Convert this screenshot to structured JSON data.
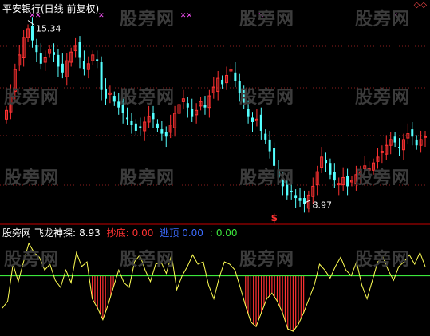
{
  "header": {
    "title": "平安银行(日线 前复权)",
    "corner_markers": "◇◇"
  },
  "main_chart": {
    "high_label": "15.34",
    "low_label": "8.97",
    "signal_mark": "$",
    "top_marks": [
      "✕✕",
      "✕",
      "✕✕",
      "✕",
      "✕"
    ]
  },
  "indicator": {
    "site_label": "股旁网",
    "name_label": "飞龙神探:",
    "name_value": "8.93",
    "bottom_label": "抄底:",
    "bottom_value": "0.00",
    "escape_label": "逃顶",
    "escape_value": "0.00",
    "extra_label": ":",
    "extra_value": "0.00"
  },
  "watermark": "股旁网",
  "colors": {
    "background": "#000000",
    "up": "#ff3232",
    "down": "#54ffff",
    "line": "#ffff54",
    "baseline": "#3ce63c",
    "divider": "#c80000",
    "bottom_bars": "#ff3232",
    "escape": "#3c6cff",
    "white": "#ffffff"
  },
  "chart_data": [
    {
      "type": "candlestick",
      "title": "平安银行(日线 前复权)",
      "annotations": [
        {
          "text": "15.34",
          "kind": "high"
        },
        {
          "text": "8.97",
          "kind": "low"
        }
      ],
      "close_series": [
        12.2,
        12.8,
        13.6,
        14.1,
        14.7,
        15.0,
        14.6,
        14.2,
        13.8,
        14.0,
        14.3,
        14.1,
        13.7,
        13.5,
        13.9,
        14.2,
        14.4,
        14.0,
        13.6,
        13.8,
        14.1,
        13.9,
        12.9,
        12.6,
        12.8,
        12.5,
        12.3,
        12.1,
        11.9,
        11.7,
        11.5,
        11.6,
        11.8,
        12.0,
        11.9,
        11.6,
        11.4,
        11.3,
        11.7,
        12.1,
        12.4,
        12.6,
        12.3,
        12.0,
        12.2,
        12.5,
        12.3,
        12.7,
        13.0,
        13.3,
        13.1,
        13.4,
        13.6,
        13.2,
        12.8,
        12.4,
        12.0,
        11.8,
        11.9,
        11.5,
        11.2,
        10.8,
        10.3,
        9.9,
        9.6,
        9.3,
        9.4,
        9.2,
        9.1,
        9.0,
        9.3,
        9.6,
        10.1,
        10.6,
        10.4,
        10.0,
        9.8,
        9.7,
        9.9,
        9.6,
        9.8,
        10.0,
        10.1,
        10.3,
        10.2,
        10.4,
        10.6,
        10.8,
        11.0,
        11.2,
        11.1,
        10.9,
        11.2,
        11.4,
        11.3,
        11.0,
        11.2,
        11.3
      ]
    },
    {
      "type": "line",
      "title": "飞龙神探",
      "last_value": 8.93,
      "baseline": 50,
      "series": [
        {
          "name": "飞龙神探",
          "values": [
            22,
            28,
            60,
            45,
            62,
            78,
            70,
            66,
            55,
            60,
            46,
            40,
            55,
            44,
            70,
            58,
            62,
            30,
            22,
            12,
            25,
            40,
            55,
            44,
            40,
            62,
            68,
            55,
            45,
            60,
            62,
            52,
            68,
            38,
            50,
            58,
            68,
            60,
            62,
            42,
            30,
            48,
            62,
            60,
            55,
            40,
            24,
            10,
            6,
            18,
            30,
            35,
            28,
            18,
            4,
            2,
            8,
            18,
            30,
            42,
            60,
            55,
            48,
            58,
            66,
            55,
            50,
            62,
            42,
            30,
            46,
            62,
            66,
            55,
            46,
            58,
            62,
            68,
            60,
            70,
            58
          ]
        },
        {
          "name": "抄底",
          "values": [
            0,
            0,
            0,
            0,
            0,
            0,
            0,
            0,
            0,
            0,
            0,
            0,
            0,
            0,
            0,
            0,
            0,
            0,
            0,
            0,
            0,
            0,
            0,
            0,
            0,
            0,
            0,
            0,
            0,
            0,
            0,
            0,
            0,
            0,
            0,
            0,
            0,
            0,
            0,
            0,
            0,
            0,
            0,
            0,
            0,
            0,
            0,
            0,
            0,
            0,
            0,
            0,
            0,
            0,
            0,
            0,
            0,
            0,
            0,
            0,
            0,
            0,
            0,
            0,
            0,
            0,
            0,
            0,
            0,
            0,
            0,
            0,
            0,
            0,
            0,
            0,
            0,
            0,
            0,
            0,
            0
          ]
        },
        {
          "name": "逃顶",
          "values": [
            0,
            0,
            0,
            0,
            0,
            0,
            0,
            0,
            0,
            0,
            0,
            0,
            0,
            0,
            0,
            0,
            0,
            0,
            0,
            0,
            0,
            0,
            0,
            0,
            0,
            0,
            0,
            0,
            0,
            0,
            0,
            0,
            0,
            0,
            0,
            0,
            0,
            0,
            0,
            0,
            0,
            0,
            0,
            0,
            0,
            0,
            0,
            0,
            0,
            0,
            0,
            0,
            0,
            0,
            0,
            0,
            0,
            0,
            0,
            0,
            0,
            0,
            0,
            0,
            0,
            0,
            0,
            0,
            0,
            0,
            0,
            0,
            0,
            0,
            0,
            0,
            0,
            0,
            0,
            0,
            0
          ]
        }
      ],
      "bottom_zones": [
        [
          17,
          21
        ],
        [
          46,
          57
        ]
      ]
    }
  ]
}
